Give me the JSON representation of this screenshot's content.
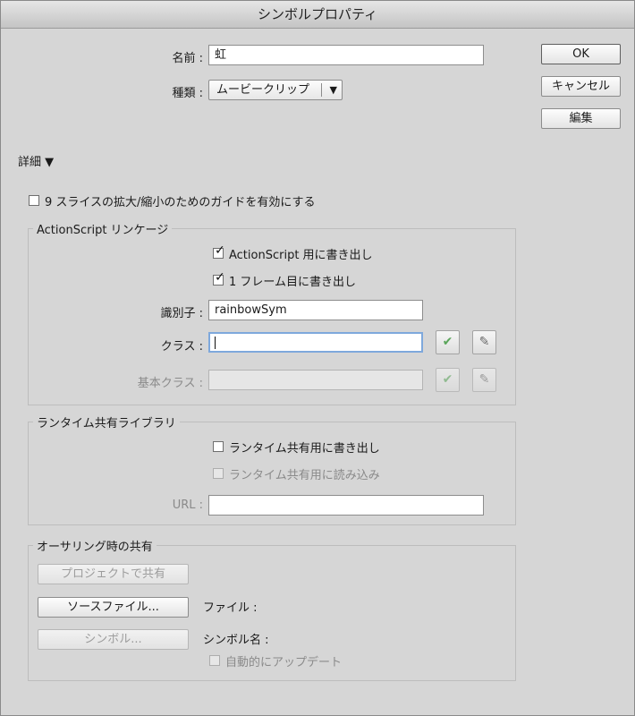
{
  "window": {
    "title": "シンボルプロパティ"
  },
  "name_field": {
    "label": "名前 :",
    "value": "虹"
  },
  "type_field": {
    "label": "種類 :",
    "value": "ムービークリップ"
  },
  "buttons": {
    "ok": "OK",
    "cancel": "キャンセル",
    "edit": "編集"
  },
  "advanced": {
    "label": "詳細 ▼"
  },
  "slice9": {
    "label": "9 スライスの拡大/縮小のためのガイドを有効にする",
    "checked": false
  },
  "linkage": {
    "title": "ActionScript リンケージ",
    "export_as": {
      "label": "ActionScript 用に書き出し",
      "checked": true
    },
    "export_first_frame": {
      "label": "1 フレーム目に書き出し",
      "checked": true
    },
    "identifier": {
      "label": "識別子 :",
      "value": "rainbowSym"
    },
    "class": {
      "label": "クラス :",
      "value": ""
    },
    "base_class": {
      "label": "基本クラス :",
      "value": ""
    },
    "icons": {
      "validate": "checkmark-icon",
      "edit": "pencil-icon"
    }
  },
  "runtime": {
    "title": "ランタイム共有ライブラリ",
    "export_runtime": {
      "label": "ランタイム共有用に書き出し",
      "checked": false
    },
    "import_runtime": {
      "label": "ランタイム共有用に読み込み",
      "checked": false
    },
    "url": {
      "label": "URL :",
      "value": ""
    }
  },
  "authoring": {
    "title": "オーサリング時の共有",
    "share_project": "プロジェクトで共有",
    "source_file": "ソースファイル...",
    "symbol": "シンボル...",
    "file_label": "ファイル :",
    "symbol_name_label": "シンボル名 :",
    "auto_update": {
      "label": "自動的にアップデート",
      "checked": false
    }
  },
  "colors": {
    "dialog_bg": "#d6d6d6",
    "focus_ring": "#7ea8dc",
    "check_green": "#5aa55a"
  }
}
